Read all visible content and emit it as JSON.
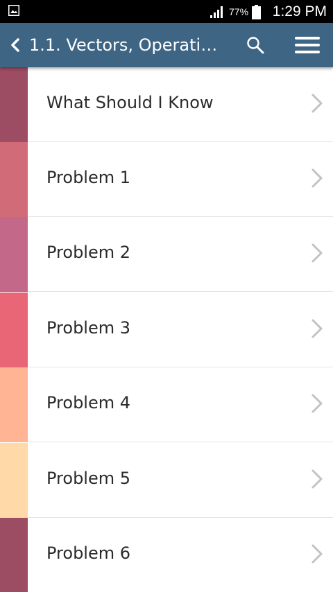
{
  "status_bar": {
    "left_icon": "gallery-icon",
    "signal_icon": "signal-icon",
    "battery_percent": "77%",
    "battery_icon": "battery-icon",
    "time": "1:29 PM"
  },
  "app_bar": {
    "background": "#3f6584",
    "back_icon": "chevron-left-icon",
    "title": "1.1. Vectors, Operati…",
    "search_icon": "search-icon",
    "menu_icon": "hamburger-menu-icon"
  },
  "list": {
    "items": [
      {
        "label": "What Should I Know",
        "color": "#9c4c63"
      },
      {
        "label": "Problem 1",
        "color": "#d26b78"
      },
      {
        "label": "Problem 2",
        "color": "#c36889"
      },
      {
        "label": "Problem 3",
        "color": "#e86676"
      },
      {
        "label": "Problem 4",
        "color": "#ffb493"
      },
      {
        "label": "Problem 5",
        "color": "#ffd9a7"
      },
      {
        "label": "Problem 6",
        "color": "#9c4c63"
      }
    ],
    "chevron_icon": "chevron-right-icon"
  }
}
